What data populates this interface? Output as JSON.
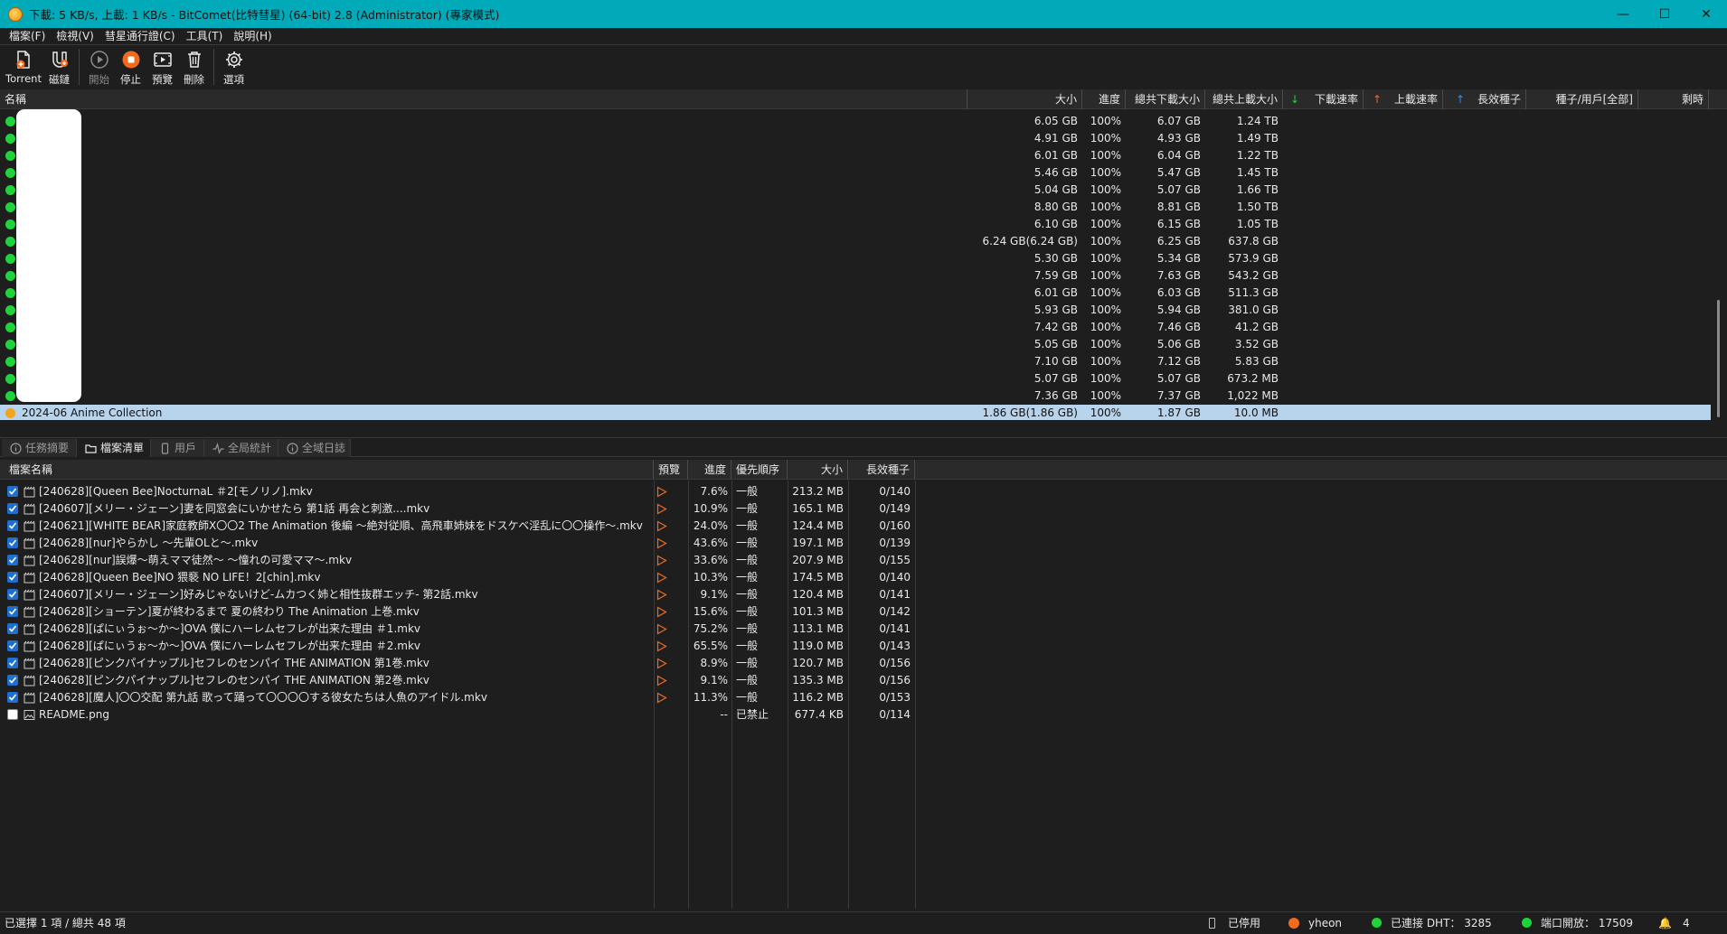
{
  "window": {
    "title": "下載: 5 KB/s,  上載: 1 KB/s - BitComet(比特彗星) (64-bit) 2.8 (Administrator) (專家模式)",
    "minimize": "—",
    "maximize": "☐",
    "close": "✕"
  },
  "menu": [
    "檔案(F)",
    "檢視(V)",
    "彗星通行證(C)",
    "工具(T)",
    "說明(H)"
  ],
  "toolbar": {
    "torrent": "Torrent",
    "magnet": "磁鏈",
    "start": "開始",
    "stop": "停止",
    "preview": "預覽",
    "delete": "刪除",
    "options": "選項"
  },
  "task_columns": {
    "name": "名稱",
    "size": "大小",
    "progress": "進度",
    "total_download": "總共下載大小",
    "total_upload": "總共上載大小",
    "download_rate": "下載速率",
    "upload_rate": "上載速率",
    "seeds": "長效種子",
    "peers": "種子/用戶[全部]",
    "time_left": "剩時"
  },
  "tasks": [
    {
      "name": "",
      "size": "6.05 GB",
      "progress": "100%",
      "downloaded": "6.07 GB",
      "uploaded": "1.24 TB"
    },
    {
      "name": "",
      "size": "4.91 GB",
      "progress": "100%",
      "downloaded": "4.93 GB",
      "uploaded": "1.49 TB"
    },
    {
      "name": "",
      "size": "6.01 GB",
      "progress": "100%",
      "downloaded": "6.04 GB",
      "uploaded": "1.22 TB"
    },
    {
      "name": "",
      "size": "5.46 GB",
      "progress": "100%",
      "downloaded": "5.47 GB",
      "uploaded": "1.45 TB"
    },
    {
      "name": "",
      "size": "5.04 GB",
      "progress": "100%",
      "downloaded": "5.07 GB",
      "uploaded": "1.66 TB"
    },
    {
      "name": "",
      "size": "8.80 GB",
      "progress": "100%",
      "downloaded": "8.81 GB",
      "uploaded": "1.50 TB"
    },
    {
      "name": "",
      "size": "6.10 GB",
      "progress": "100%",
      "downloaded": "6.15 GB",
      "uploaded": "1.05 TB"
    },
    {
      "name": "",
      "size": "6.24 GB(6.24 GB)",
      "progress": "100%",
      "downloaded": "6.25 GB",
      "uploaded": "637.8 GB"
    },
    {
      "name": "",
      "size": "5.30 GB",
      "progress": "100%",
      "downloaded": "5.34 GB",
      "uploaded": "573.9 GB"
    },
    {
      "name": "",
      "size": "7.59 GB",
      "progress": "100%",
      "downloaded": "7.63 GB",
      "uploaded": "543.2 GB"
    },
    {
      "name": "",
      "size": "6.01 GB",
      "progress": "100%",
      "downloaded": "6.03 GB",
      "uploaded": "511.3 GB"
    },
    {
      "name": "",
      "size": "5.93 GB",
      "progress": "100%",
      "downloaded": "5.94 GB",
      "uploaded": "381.0 GB"
    },
    {
      "name": "",
      "size": "7.42 GB",
      "progress": "100%",
      "downloaded": "7.46 GB",
      "uploaded": "41.2 GB"
    },
    {
      "name": "",
      "size": "5.05 GB",
      "progress": "100%",
      "downloaded": "5.06 GB",
      "uploaded": "3.52 GB"
    },
    {
      "name": "",
      "size": "7.10 GB",
      "progress": "100%",
      "downloaded": "7.12 GB",
      "uploaded": "5.83 GB"
    },
    {
      "name": "",
      "size": "5.07 GB",
      "progress": "100%",
      "downloaded": "5.07 GB",
      "uploaded": "673.2 MB"
    },
    {
      "name": "",
      "size": "7.36 GB",
      "progress": "100%",
      "downloaded": "7.37 GB",
      "uploaded": "1,022 MB"
    },
    {
      "name": "2024-06 Anime Collection",
      "size": "1.86 GB(1.86 GB)",
      "progress": "100%",
      "downloaded": "1.87 GB",
      "uploaded": "10.0 MB",
      "selected": true
    }
  ],
  "tabs": [
    "任務摘要",
    "檔案清單",
    "用戶",
    "全局統計",
    "全域日誌"
  ],
  "active_tab": 1,
  "file_columns": {
    "name": "檔案名稱",
    "preview": "預覽",
    "progress": "進度",
    "priority": "優先順序",
    "size": "大小",
    "seeds": "長效種子"
  },
  "files": [
    {
      "name": "[240628][Queen Bee]NocturnaL ＃2[モノリノ].mkv",
      "progress": "7.6%",
      "priority": "一般",
      "size": "213.2 MB",
      "seeds": "0/140",
      "checked": true,
      "preview": true
    },
    {
      "name": "[240607][メリー・ジェーン]妻を同窓会にいかせたら 第1話 再会と刺激....mkv",
      "progress": "10.9%",
      "priority": "一般",
      "size": "165.1 MB",
      "seeds": "0/149",
      "checked": true,
      "preview": true
    },
    {
      "name": "[240621][WHITE BEAR]家庭教師X〇〇2 The Animation 後編 ～絶対従順、高飛車姉妹をドスケベ淫乱に〇〇操作～.mkv",
      "progress": "24.0%",
      "priority": "一般",
      "size": "124.4 MB",
      "seeds": "0/160",
      "checked": true,
      "preview": true
    },
    {
      "name": "[240628][nur]やらかし ～先輩OLと～.mkv",
      "progress": "43.6%",
      "priority": "一般",
      "size": "197.1 MB",
      "seeds": "0/139",
      "checked": true,
      "preview": true
    },
    {
      "name": "[240628][nur]誤爆～萌えママ徒然～ ～憧れの可愛ママ～.mkv",
      "progress": "33.6%",
      "priority": "一般",
      "size": "207.9 MB",
      "seeds": "0/155",
      "checked": true,
      "preview": true
    },
    {
      "name": "[240628][Queen Bee]NO 猥褻 NO LIFE！2[chin].mkv",
      "progress": "10.3%",
      "priority": "一般",
      "size": "174.5 MB",
      "seeds": "0/140",
      "checked": true,
      "preview": true
    },
    {
      "name": "[240607][メリー・ジェーン]好みじゃないけど-ムカつく姉と相性抜群エッチ- 第2話.mkv",
      "progress": "9.1%",
      "priority": "一般",
      "size": "120.4 MB",
      "seeds": "0/141",
      "checked": true,
      "preview": true
    },
    {
      "name": "[240628][ショーテン]夏が終わるまで 夏の終わり The Animation 上巻.mkv",
      "progress": "15.6%",
      "priority": "一般",
      "size": "101.3 MB",
      "seeds": "0/142",
      "checked": true,
      "preview": true
    },
    {
      "name": "[240628][ぱにぃうぉ～か～]OVA 僕にハーレムセフレが出来た理由 ＃1.mkv",
      "progress": "75.2%",
      "priority": "一般",
      "size": "113.1 MB",
      "seeds": "0/141",
      "checked": true,
      "preview": true
    },
    {
      "name": "[240628][ぱにぃうぉ～か～]OVA 僕にハーレムセフレが出来た理由 ＃2.mkv",
      "progress": "65.5%",
      "priority": "一般",
      "size": "119.0 MB",
      "seeds": "0/143",
      "checked": true,
      "preview": true
    },
    {
      "name": "[240628][ピンクパイナップル]セフレのセンパイ THE ANIMATION 第1巻.mkv",
      "progress": "8.9%",
      "priority": "一般",
      "size": "120.7 MB",
      "seeds": "0/156",
      "checked": true,
      "preview": true
    },
    {
      "name": "[240628][ピンクパイナップル]セフレのセンパイ THE ANIMATION 第2巻.mkv",
      "progress": "9.1%",
      "priority": "一般",
      "size": "135.3 MB",
      "seeds": "0/156",
      "checked": true,
      "preview": true
    },
    {
      "name": "[240628][魔人]〇〇交配 第九話 歌って踊って〇〇〇〇する彼女たちは人魚のアイドル.mkv",
      "progress": "11.3%",
      "priority": "一般",
      "size": "116.2 MB",
      "seeds": "0/153",
      "checked": true,
      "preview": true
    },
    {
      "name": "README.png",
      "progress": "--",
      "priority": "已禁止",
      "size": "677.4 KB",
      "seeds": "0/114",
      "checked": false,
      "preview": false,
      "image": true
    }
  ],
  "status": {
    "selection": "已選擇 1 項 / 總共 48 項",
    "disabled": "已停用",
    "user": "yheon",
    "dht": "已連接 DHT： 3285",
    "port": "端口開放： 17509",
    "notifications": "4"
  },
  "colors": {
    "titlebar": "#00aab8",
    "background": "#1e1e1e",
    "selected_row": "#b8d4ec",
    "status_green": "#1fd43a",
    "status_yellow": "#f3a41a",
    "accent_orange": "#f26b1d",
    "checkbox_blue": "#1f6fd1"
  }
}
